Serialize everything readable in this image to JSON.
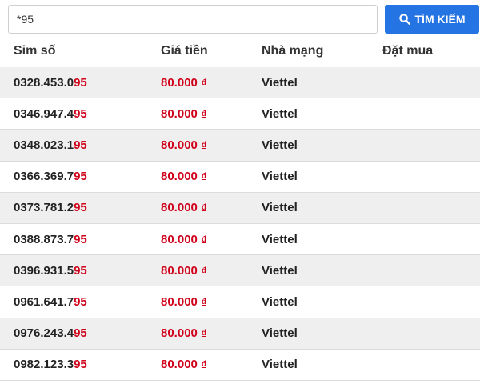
{
  "search": {
    "value": "*95",
    "button_label": "TÌM KIẾM"
  },
  "table": {
    "headers": [
      "Sim số",
      "Giá tiền",
      "Nhà mạng",
      "Đặt mua"
    ],
    "rows": [
      {
        "number_prefix": "0328.453.0",
        "number_suffix": "95",
        "price": "80.000",
        "currency": "đ",
        "carrier": "Viettel"
      },
      {
        "number_prefix": "0346.947.4",
        "number_suffix": "95",
        "price": "80.000",
        "currency": "đ",
        "carrier": "Viettel"
      },
      {
        "number_prefix": "0348.023.1",
        "number_suffix": "95",
        "price": "80.000",
        "currency": "đ",
        "carrier": "Viettel"
      },
      {
        "number_prefix": "0366.369.7",
        "number_suffix": "95",
        "price": "80.000",
        "currency": "đ",
        "carrier": "Viettel"
      },
      {
        "number_prefix": "0373.781.2",
        "number_suffix": "95",
        "price": "80.000",
        "currency": "đ",
        "carrier": "Viettel"
      },
      {
        "number_prefix": "0388.873.7",
        "number_suffix": "95",
        "price": "80.000",
        "currency": "đ",
        "carrier": "Viettel"
      },
      {
        "number_prefix": "0396.931.5",
        "number_suffix": "95",
        "price": "80.000",
        "currency": "đ",
        "carrier": "Viettel"
      },
      {
        "number_prefix": "0961.641.7",
        "number_suffix": "95",
        "price": "80.000",
        "currency": "đ",
        "carrier": "Viettel"
      },
      {
        "number_prefix": "0976.243.4",
        "number_suffix": "95",
        "price": "80.000",
        "currency": "đ",
        "carrier": "Viettel"
      },
      {
        "number_prefix": "0982.123.3",
        "number_suffix": "95",
        "price": "80.000",
        "currency": "đ",
        "carrier": "Viettel"
      }
    ]
  },
  "colors": {
    "accent": "#2574e3",
    "price": "#d0021b",
    "row_stripe": "#efefef"
  },
  "icons": {
    "search_button": "search-icon"
  }
}
